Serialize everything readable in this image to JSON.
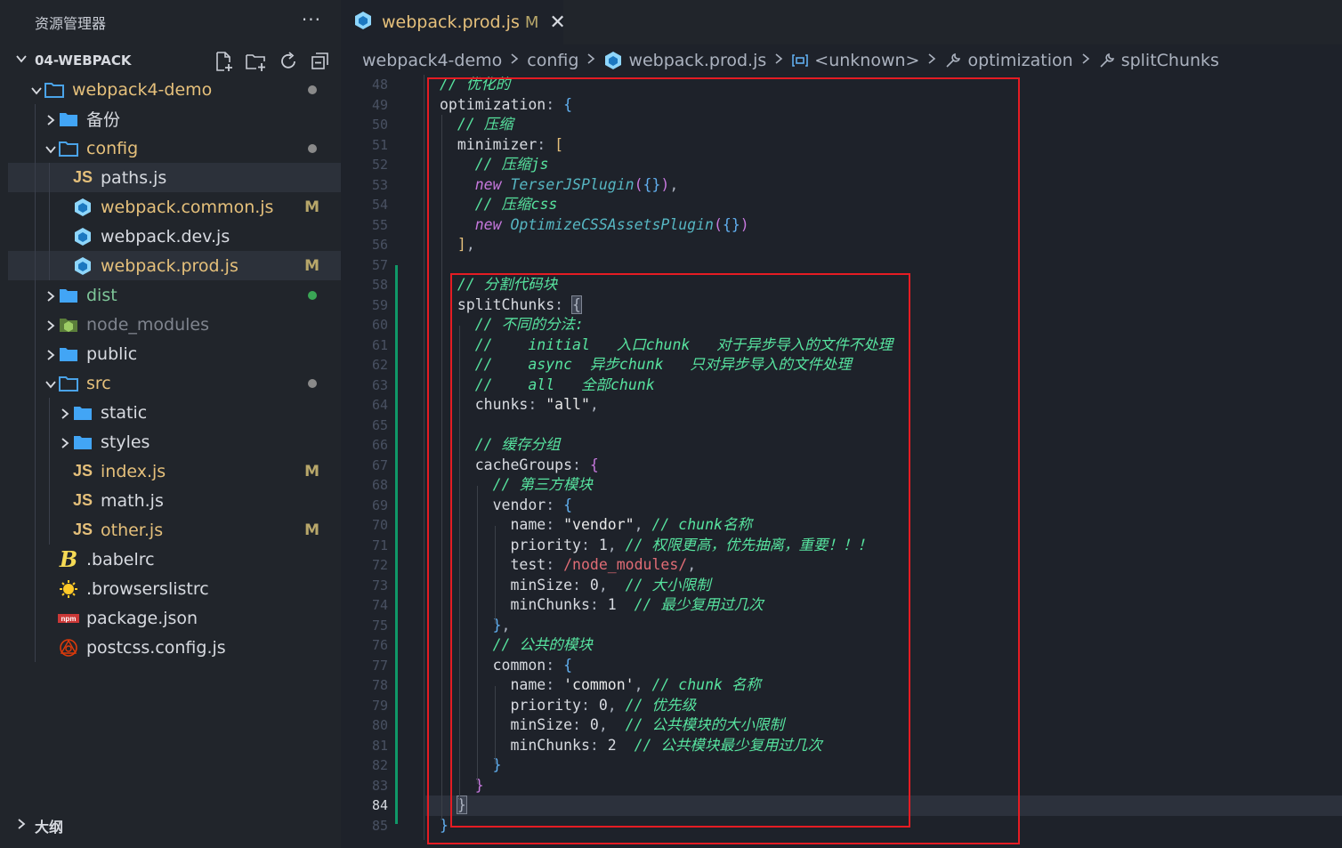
{
  "sidebar": {
    "title": "资源管理器",
    "more_label": "···",
    "workspace": "04-WEBPACK",
    "tree": [
      {
        "label": "webpack4-demo",
        "kind": "folder-open",
        "depth": 1,
        "dot": "#8a8a8a",
        "color": "#e5c07b"
      },
      {
        "label": "备份",
        "kind": "folder",
        "depth": 2
      },
      {
        "label": "config",
        "kind": "folder-open",
        "depth": 2,
        "dot": "#8a8a8a",
        "color": "#e5c07b"
      },
      {
        "label": "paths.js",
        "kind": "js",
        "depth": 3,
        "selected": true
      },
      {
        "label": "webpack.common.js",
        "kind": "webpack",
        "depth": 3,
        "deco": "M",
        "color": "#e5c07b"
      },
      {
        "label": "webpack.dev.js",
        "kind": "webpack",
        "depth": 3
      },
      {
        "label": "webpack.prod.js",
        "kind": "webpack",
        "depth": 3,
        "deco": "M",
        "selected": true,
        "color": "#e5c07b"
      },
      {
        "label": "dist",
        "kind": "folder",
        "depth": 2,
        "dot": "#3aa655",
        "color": "#7ec699"
      },
      {
        "label": "node_modules",
        "kind": "node",
        "depth": 2,
        "color": "#7f848e"
      },
      {
        "label": "public",
        "kind": "folder",
        "depth": 2
      },
      {
        "label": "src",
        "kind": "folder-open",
        "depth": 2,
        "dot": "#8a8a8a",
        "color": "#e5c07b"
      },
      {
        "label": "static",
        "kind": "folder",
        "depth": 3
      },
      {
        "label": "styles",
        "kind": "folder",
        "depth": 3
      },
      {
        "label": "index.js",
        "kind": "js",
        "depth": 3,
        "deco": "M",
        "color": "#e5c07b"
      },
      {
        "label": "math.js",
        "kind": "js",
        "depth": 3
      },
      {
        "label": "other.js",
        "kind": "js",
        "depth": 3,
        "deco": "M",
        "color": "#e5c07b"
      },
      {
        "label": ".babelrc",
        "kind": "babel",
        "depth": 2
      },
      {
        "label": ".browserslistrc",
        "kind": "browsers",
        "depth": 2
      },
      {
        "label": "package.json",
        "kind": "npm",
        "depth": 2
      },
      {
        "label": "postcss.config.js",
        "kind": "postcss",
        "depth": 2
      }
    ],
    "outline_label": "大纲"
  },
  "tab": {
    "name": "webpack.prod.js",
    "status": "M",
    "close": "✕"
  },
  "breadcrumbs": [
    "webpack4-demo",
    "config",
    "webpack.prod.js",
    "<unknown>",
    "optimization",
    "splitChunks"
  ],
  "editor": {
    "first_line": 48,
    "active_line": 84,
    "lines": [
      [
        [
          "cmt",
          "// 优化的"
        ]
      ],
      [
        [
          "prop",
          "optimization"
        ],
        [
          "k",
          ": "
        ],
        [
          "br1",
          "{"
        ]
      ],
      [
        [
          "k",
          "  "
        ],
        [
          "cmt",
          "// 压缩"
        ]
      ],
      [
        [
          "k",
          "  "
        ],
        [
          "prop",
          "minimizer"
        ],
        [
          "k",
          ": "
        ],
        [
          "br3",
          "["
        ]
      ],
      [
        [
          "k",
          "    "
        ],
        [
          "cmt",
          "// 压缩js"
        ]
      ],
      [
        [
          "k",
          "    "
        ],
        [
          "kw",
          "new "
        ],
        [
          "fn",
          "TerserJSPlugin"
        ],
        [
          "br2",
          "("
        ],
        [
          "br1",
          "{}"
        ],
        [
          "br2",
          ")"
        ],
        [
          "k",
          ","
        ]
      ],
      [
        [
          "k",
          "    "
        ],
        [
          "cmt",
          "// 压缩css"
        ]
      ],
      [
        [
          "k",
          "    "
        ],
        [
          "kw",
          "new "
        ],
        [
          "fn",
          "OptimizeCSSAssetsPlugin"
        ],
        [
          "br2",
          "("
        ],
        [
          "br1",
          "{}"
        ],
        [
          "br2",
          ")"
        ]
      ],
      [
        [
          "k",
          "  "
        ],
        [
          "br3",
          "]"
        ],
        [
          "k",
          ","
        ]
      ],
      [
        [
          "k",
          ""
        ]
      ],
      [
        [
          "k",
          "  "
        ],
        [
          "cmt",
          "// 分割代码块"
        ]
      ],
      [
        [
          "k",
          "  "
        ],
        [
          "prop",
          "splitChunks"
        ],
        [
          "k",
          ": "
        ],
        [
          "brm",
          "{"
        ]
      ],
      [
        [
          "k",
          "    "
        ],
        [
          "cmt",
          "// 不同的分法:"
        ]
      ],
      [
        [
          "k",
          "    "
        ],
        [
          "cmt",
          "//    initial   入口chunk   对于异步导入的文件不处理"
        ]
      ],
      [
        [
          "k",
          "    "
        ],
        [
          "cmt",
          "//    async  异步chunk   只对异步导入的文件处理"
        ]
      ],
      [
        [
          "k",
          "    "
        ],
        [
          "cmt",
          "//    all   全部chunk"
        ]
      ],
      [
        [
          "k",
          "    "
        ],
        [
          "prop",
          "chunks"
        ],
        [
          "k",
          ": "
        ],
        [
          "str",
          "\"all\""
        ],
        [
          "k",
          ","
        ]
      ],
      [
        [
          "k",
          ""
        ]
      ],
      [
        [
          "k",
          "    "
        ],
        [
          "cmt",
          "// 缓存分组"
        ]
      ],
      [
        [
          "k",
          "    "
        ],
        [
          "prop",
          "cacheGroups"
        ],
        [
          "k",
          ": "
        ],
        [
          "br2",
          "{"
        ]
      ],
      [
        [
          "k",
          "      "
        ],
        [
          "cmt",
          "// 第三方模块"
        ]
      ],
      [
        [
          "k",
          "      "
        ],
        [
          "prop",
          "vendor"
        ],
        [
          "k",
          ": "
        ],
        [
          "br1",
          "{"
        ]
      ],
      [
        [
          "k",
          "        "
        ],
        [
          "prop",
          "name"
        ],
        [
          "k",
          ": "
        ],
        [
          "str",
          "\"vendor\""
        ],
        [
          "k",
          ", "
        ],
        [
          "cmt",
          "// chunk名称"
        ]
      ],
      [
        [
          "k",
          "        "
        ],
        [
          "prop",
          "priority"
        ],
        [
          "k",
          ": "
        ],
        [
          "num",
          "1"
        ],
        [
          "k",
          ", "
        ],
        [
          "cmt",
          "// 权限更高，优先抽离，重要！！！"
        ]
      ],
      [
        [
          "k",
          "        "
        ],
        [
          "prop",
          "test"
        ],
        [
          "k",
          ": "
        ],
        [
          "re",
          "/node_modules/"
        ],
        [
          "k",
          ","
        ]
      ],
      [
        [
          "k",
          "        "
        ],
        [
          "prop",
          "minSize"
        ],
        [
          "k",
          ": "
        ],
        [
          "num",
          "0"
        ],
        [
          "k",
          ",  "
        ],
        [
          "cmt",
          "// 大小限制"
        ]
      ],
      [
        [
          "k",
          "        "
        ],
        [
          "prop",
          "minChunks"
        ],
        [
          "k",
          ": "
        ],
        [
          "num",
          "1"
        ],
        [
          "k",
          "  "
        ],
        [
          "cmt",
          "// 最少复用过几次"
        ]
      ],
      [
        [
          "k",
          "      "
        ],
        [
          "br1",
          "}"
        ],
        [
          "k",
          ","
        ]
      ],
      [
        [
          "k",
          "      "
        ],
        [
          "cmt",
          "// 公共的模块"
        ]
      ],
      [
        [
          "k",
          "      "
        ],
        [
          "prop",
          "common"
        ],
        [
          "k",
          ": "
        ],
        [
          "br1",
          "{"
        ]
      ],
      [
        [
          "k",
          "        "
        ],
        [
          "prop",
          "name"
        ],
        [
          "k",
          ": "
        ],
        [
          "str",
          "'common'"
        ],
        [
          "k",
          ", "
        ],
        [
          "cmt",
          "// chunk 名称"
        ]
      ],
      [
        [
          "k",
          "        "
        ],
        [
          "prop",
          "priority"
        ],
        [
          "k",
          ": "
        ],
        [
          "num",
          "0"
        ],
        [
          "k",
          ", "
        ],
        [
          "cmt",
          "// 优先级"
        ]
      ],
      [
        [
          "k",
          "        "
        ],
        [
          "prop",
          "minSize"
        ],
        [
          "k",
          ": "
        ],
        [
          "num",
          "0"
        ],
        [
          "k",
          ",  "
        ],
        [
          "cmt",
          "// 公共模块的大小限制"
        ]
      ],
      [
        [
          "k",
          "        "
        ],
        [
          "prop",
          "minChunks"
        ],
        [
          "k",
          ": "
        ],
        [
          "num",
          "2"
        ],
        [
          "k",
          "  "
        ],
        [
          "cmt",
          "// 公共模块最少复用过几次"
        ]
      ],
      [
        [
          "k",
          "      "
        ],
        [
          "br1",
          "}"
        ]
      ],
      [
        [
          "k",
          "    "
        ],
        [
          "br2",
          "}"
        ]
      ],
      [
        [
          "k",
          "  "
        ],
        [
          "brm",
          "}"
        ]
      ],
      [
        [
          "br1",
          "}"
        ]
      ]
    ]
  },
  "colors": {
    "box": "#e51c23",
    "git_added": "#109868",
    "accent": "#e5c07b"
  }
}
